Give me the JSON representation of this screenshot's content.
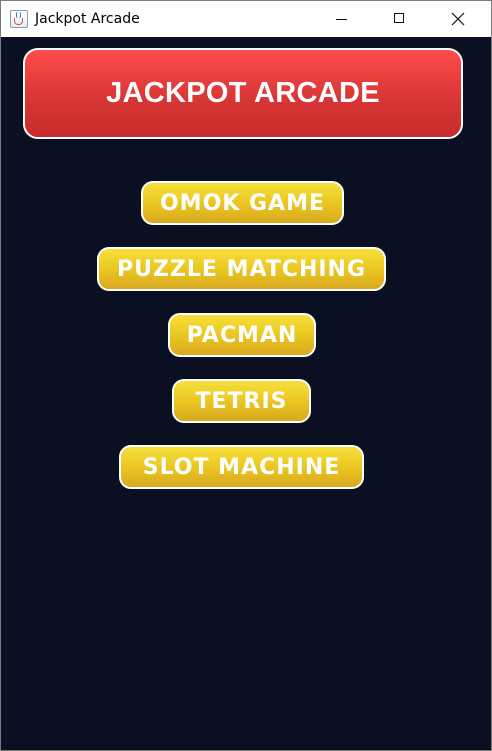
{
  "window": {
    "title": "Jackpot Arcade",
    "app_icon": "java-cup-icon",
    "controls": [
      "minimize-icon",
      "maximize-icon",
      "close-icon"
    ]
  },
  "banner": {
    "text": "JACKPOT ARCADE",
    "color": "#e03a3a"
  },
  "menu": {
    "accent_color": "#eacb26",
    "background_color": "#0b0f22",
    "items": [
      {
        "label": "OMOK GAME"
      },
      {
        "label": "PUZZLE MATCHING"
      },
      {
        "label": "PACMAN"
      },
      {
        "label": "TETRIS"
      },
      {
        "label": "SLOT MACHINE"
      }
    ]
  }
}
